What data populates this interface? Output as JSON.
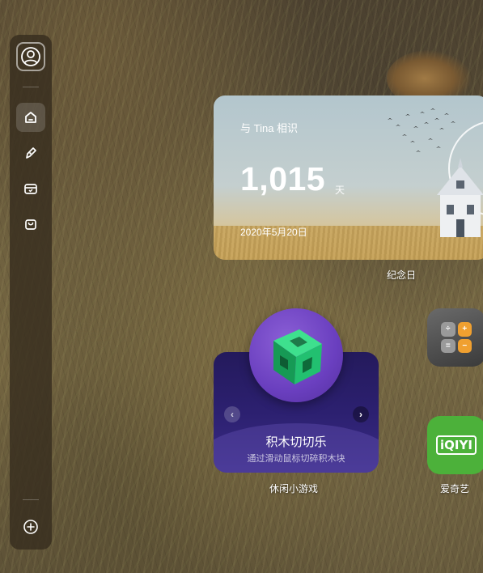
{
  "sidebar": {
    "avatar": "user-avatar-icon",
    "items": [
      {
        "icon": "home-icon",
        "active": true
      },
      {
        "icon": "pen-icon",
        "active": false
      },
      {
        "icon": "game-controller-icon",
        "active": false
      },
      {
        "icon": "shopping-bag-icon",
        "active": false
      }
    ],
    "add": "plus-circle-icon"
  },
  "anniversary_widget": {
    "title": "与 Tina 相识",
    "days": "1,015",
    "unit": "天",
    "date": "2020年5月20日",
    "caption": "纪念日"
  },
  "game_widget": {
    "title": "积木切切乐",
    "description": "通过滑动鼠标切碎积木块",
    "prev": "‹",
    "next": "›",
    "caption": "休闲小游戏"
  },
  "apps": [
    {
      "name": "calculator",
      "caption": ""
    },
    {
      "name": "iqiyi",
      "logo_text": "iQIYI",
      "caption": "爱奇艺"
    }
  ],
  "colors": {
    "sidebar_bg": "#372d1e",
    "game_card_bg": "#2c2070",
    "iqiyi_green": "#4cb13a",
    "calc_orange": "#f0a030"
  }
}
